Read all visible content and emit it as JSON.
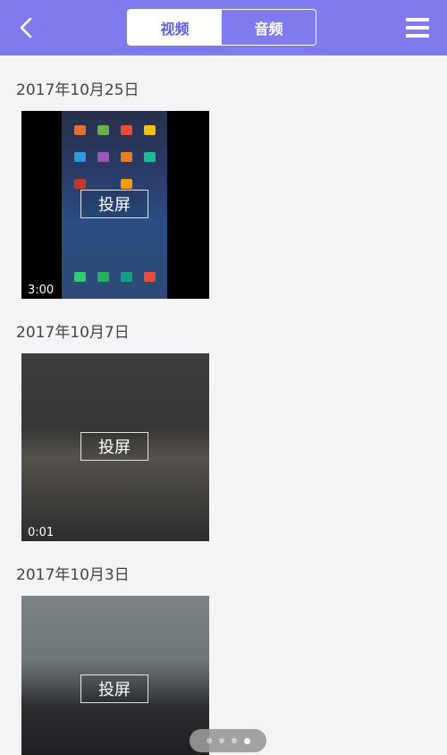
{
  "header": {
    "tabs": [
      {
        "label": "视频",
        "active": true
      },
      {
        "label": "音频",
        "active": false
      }
    ],
    "accent_color": "#7f7aee",
    "back_icon": "chevron-left-icon",
    "menu_icon": "hamburger-menu-icon"
  },
  "groups": [
    {
      "date": "2017年10月25日",
      "video": {
        "cast_label": "投屏",
        "duration": "3:00"
      }
    },
    {
      "date": "2017年10月7日",
      "video": {
        "cast_label": "投屏",
        "duration": "0:01"
      }
    },
    {
      "date": "2017年10月3日",
      "video": {
        "cast_label": "投屏",
        "duration": ""
      }
    }
  ],
  "page_indicator": {
    "count": 4,
    "active_index": 3
  }
}
